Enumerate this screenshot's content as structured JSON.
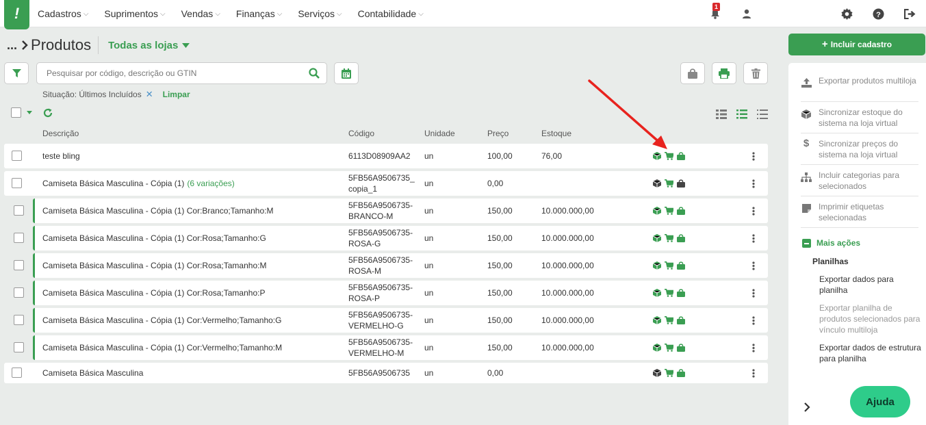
{
  "logo": "!",
  "menu": [
    {
      "label": "Cadastros"
    },
    {
      "label": "Suprimentos"
    },
    {
      "label": "Vendas"
    },
    {
      "label": "Finanças"
    },
    {
      "label": "Serviços"
    },
    {
      "label": "Contabilidade"
    }
  ],
  "notifications": {
    "count": "1"
  },
  "heading": {
    "breadcrumb_dots": "...",
    "title": "Produtos",
    "store_selector": "Todas as lojas"
  },
  "search": {
    "placeholder": "Pesquisar por código, descrição ou GTIN",
    "value": ""
  },
  "filter": {
    "label": "Situação: Últimos Incluídos",
    "remove_symbol": "✕",
    "clear_label": "Limpar"
  },
  "columns": {
    "description": "Descrição",
    "code": "Código",
    "unit": "Unidade",
    "price": "Preço",
    "stock": "Estoque"
  },
  "rows": [
    {
      "description": "teste bling",
      "variations": "",
      "code": "6113D08909AA2",
      "unit": "un",
      "price": "100,00",
      "stock": "76,00",
      "variation_row": false
    },
    {
      "description": "Camiseta Básica Masculina - Cópia (1)",
      "variations": "(6 variações)",
      "code": "5FB56A9506735_ copia_1",
      "unit": "un",
      "price": "0,00",
      "stock": "",
      "variation_row": false
    },
    {
      "description": "Camiseta Básica Masculina - Cópia (1) Cor:Branco;Tamanho:M",
      "variations": "",
      "code": "5FB56A9506735- BRANCO-M",
      "unit": "un",
      "price": "150,00",
      "stock": "10.000.000,00",
      "variation_row": true
    },
    {
      "description": "Camiseta Básica Masculina - Cópia (1) Cor:Rosa;Tamanho:G",
      "variations": "",
      "code": "5FB56A9506735- ROSA-G",
      "unit": "un",
      "price": "150,00",
      "stock": "10.000.000,00",
      "variation_row": true
    },
    {
      "description": "Camiseta Básica Masculina - Cópia (1) Cor:Rosa;Tamanho:M",
      "variations": "",
      "code": "5FB56A9506735- ROSA-M",
      "unit": "un",
      "price": "150,00",
      "stock": "10.000.000,00",
      "variation_row": true
    },
    {
      "description": "Camiseta Básica Masculina - Cópia (1) Cor:Rosa;Tamanho:P",
      "variations": "",
      "code": "5FB56A9506735- ROSA-P",
      "unit": "un",
      "price": "150,00",
      "stock": "10.000.000,00",
      "variation_row": true
    },
    {
      "description": "Camiseta Básica Masculina - Cópia (1) Cor:Vermelho;Tamanho:G",
      "variations": "",
      "code": "5FB56A9506735- VERMELHO-G",
      "unit": "un",
      "price": "150,00",
      "stock": "10.000.000,00",
      "variation_row": true
    },
    {
      "description": "Camiseta Básica Masculina - Cópia (1) Cor:Vermelho;Tamanho:M",
      "variations": "",
      "code": "5FB56A9506735- VERMELHO-M",
      "unit": "un",
      "price": "150,00",
      "stock": "10.000.000,00",
      "variation_row": true
    },
    {
      "description": "Camiseta Básica Masculina",
      "variations": "",
      "code": "5FB56A9506735",
      "unit": "un",
      "price": "0,00",
      "stock": "",
      "variation_row": false
    }
  ],
  "right_panel": {
    "include_button": "Incluir cadastro",
    "actions": [
      {
        "label": "Exportar produtos multiloja",
        "icon": "upload-icon"
      },
      {
        "label": "Sincronizar estoque do sistema na loja virtual",
        "icon": "box-icon"
      },
      {
        "label": "Sincronizar preços do sistema na loja virtual",
        "icon": "dollar-icon"
      },
      {
        "label": "Incluir categorias para selecionados",
        "icon": "sitemap-icon"
      },
      {
        "label": "Imprimir etiquetas selecionadas",
        "icon": "label-icon"
      }
    ],
    "more_actions": "Mais ações",
    "spreadsheets_title": "Planilhas",
    "spreadsheet_actions": [
      {
        "label": "Exportar dados para planilha",
        "enabled": true
      },
      {
        "label": "Exportar planilha de produtos selecionados para vínculo multiloja",
        "enabled": false
      },
      {
        "label": "Exportar dados de estrutura para planilha",
        "enabled": true
      }
    ]
  },
  "help_button": "Ajuda",
  "colors": {
    "brand": "#3a9e52",
    "help": "#2ecc8a",
    "badge": "#d9282b",
    "annotation_arrow": "#e8231e"
  }
}
